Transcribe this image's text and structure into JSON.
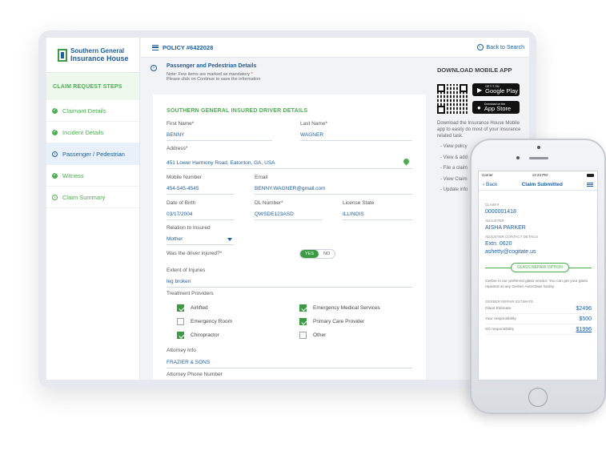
{
  "sidebar": {
    "logo_line1": "Southern General",
    "logo_line2": "Insurance House",
    "steps_title": "CLAIM REQUEST STEPS",
    "steps": [
      {
        "label": "Claimant Details",
        "state": "done"
      },
      {
        "label": "Incident Details",
        "state": "done"
      },
      {
        "label": "Passenger / Pedestrian",
        "state": "active"
      },
      {
        "label": "Witness",
        "state": "done"
      },
      {
        "label": "Claim Summary",
        "state": "pending"
      }
    ]
  },
  "header": {
    "policy": "POLICY #6422028",
    "back_to_search": "Back to Search"
  },
  "section": {
    "title": "Passenger and Pedestrian Details",
    "note_line1": "Note: Few items are marked as mandatory",
    "note_mark": "*",
    "note_line2": "Please click on Continue to save the information"
  },
  "form": {
    "title": "SOUTHERN GENERAL INSURED DRIVER DETAILS",
    "first_name_label": "First Name*",
    "first_name": "BENNY",
    "last_name_label": "Last Name*",
    "last_name": "WAGNER",
    "address_label": "Address*",
    "address": "451 Lower Harmony Road, Eatonton, GA, USA",
    "mobile_label": "Mobile Number",
    "mobile": "454-545-4545",
    "email_label": "Email",
    "email": "BENNY.WAGNER@gmail.com",
    "dob_label": "Date of Birth",
    "dob": "03/17/2004",
    "dl_label": "DL Number*",
    "dl": "QWSDE123ASD",
    "license_state_label": "License State",
    "license_state": "ILLINOIS",
    "relation_label": "Relation to Insured",
    "relation": "Mother",
    "injured_label": "Was the driver injured?*",
    "yes": "YES",
    "no": "NO",
    "injured": "YES",
    "extent_label": "Extent of Injuries",
    "extent": "leg broken",
    "treatment_label": "Treatment Providers",
    "providers": [
      {
        "label": "Airlifted",
        "checked": true
      },
      {
        "label": "Emergency Medical Services",
        "checked": true
      },
      {
        "label": "Emergency Room",
        "checked": false
      },
      {
        "label": "Primary Care Provider",
        "checked": true
      },
      {
        "label": "Chiropractor",
        "checked": true
      },
      {
        "label": "Other",
        "checked": false
      }
    ],
    "attorney_info_label": "Attorney Info",
    "attorney_info": "FRAZIER & SONS",
    "attorney_phone_label": "Attorney Phone Number"
  },
  "download": {
    "title": "DOWNLOAD MOBILE APP",
    "google_small": "GET IT ON",
    "google_big": "Google Play",
    "apple_small": "Download on the",
    "apple_big": "App Store",
    "desc": "Download the Insurance House Mobile app to easily do most of your insurance related task.",
    "list": [
      "- View policy",
      "- View & add",
      "- File a claim",
      "- View Claim",
      "- Update info"
    ]
  },
  "phone": {
    "carrier": "Carrier",
    "time": "12:23 PM",
    "back": "Back",
    "title": "Claim Submitted",
    "claim_label": "CLAIM #",
    "claim": "0000001418",
    "adjuster_label": "ADJUSTER",
    "adjuster": "AISHA PARKER",
    "contact_label": "ADJUSTER CONTACT DETAILS",
    "ext": "Extn. 0620",
    "email": "ashetty@cogitate.us",
    "glass_pill": "GLASS REPAIR OPTION",
    "glass_note": "Gerber is our preferred glass vendor. You can get your glass repaired at any Gerber AutoGlass facility.",
    "estimate_label": "GERBER REPAIR ESTIMATE",
    "rows": [
      {
        "label": "Glass Estimate",
        "amount": "$2496"
      },
      {
        "label": "Your responsibility",
        "amount": "$500"
      },
      {
        "label": "SG responsibility",
        "amount": "$1996"
      }
    ]
  },
  "colors": {
    "brand_blue": "#1f5fa0",
    "brand_green": "#4bae4f"
  }
}
